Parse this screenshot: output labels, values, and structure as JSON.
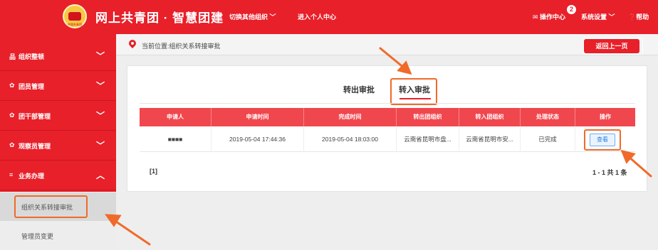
{
  "header": {
    "title": "网上共青团 · 智慧团建",
    "switch_org": "切换其他组织",
    "personal_center": "进入个人中心",
    "ops_center": "操作中心",
    "ops_badge": "2",
    "settings": "系统设置",
    "help": "帮助",
    "logo_text": "中国共青团"
  },
  "sidebar": {
    "items": [
      {
        "icon": "org-icon",
        "glyph": "品",
        "label": "组织整顿",
        "state": "collapsed"
      },
      {
        "icon": "member-icon",
        "glyph": "✿",
        "label": "团员管理",
        "state": "collapsed"
      },
      {
        "icon": "cadre-icon",
        "glyph": "✿",
        "label": "团干部管理",
        "state": "collapsed"
      },
      {
        "icon": "observer-icon",
        "glyph": "✿",
        "label": "观察员管理",
        "state": "collapsed"
      },
      {
        "icon": "list-icon",
        "glyph": "≡",
        "label": "业务办理",
        "state": "expanded"
      }
    ],
    "sub_items": [
      {
        "label": "组织关系转接审批",
        "active": true
      },
      {
        "label": "管理员变更",
        "active": false
      }
    ]
  },
  "breadcrumb": {
    "text": "当前位置:组织关系转接审批",
    "back": "返回上一页"
  },
  "tabs": [
    {
      "label": "转出审批",
      "active": false
    },
    {
      "label": "转入审批",
      "active": true
    }
  ],
  "table": {
    "headers": [
      "申请人",
      "申请时间",
      "完成时间",
      "转出团组织",
      "转入团组织",
      "处理状态",
      "操作"
    ],
    "rows": [
      {
        "applicant": "■■■■",
        "apply_time": "2019-05-04 17:44:36",
        "finish_time": "2019-05-04 18:03:00",
        "out_org": "云南省昆明市盘...",
        "in_org": "云南省昆明市安...",
        "status": "已完成",
        "action": "查看"
      }
    ]
  },
  "pagination": {
    "page": "[1]",
    "total": "1 - 1  共 1 条"
  },
  "colors": {
    "brand_red": "#e8202a",
    "annotation_orange": "#f06a2a",
    "view_button_blue": "#2b7fdf"
  }
}
